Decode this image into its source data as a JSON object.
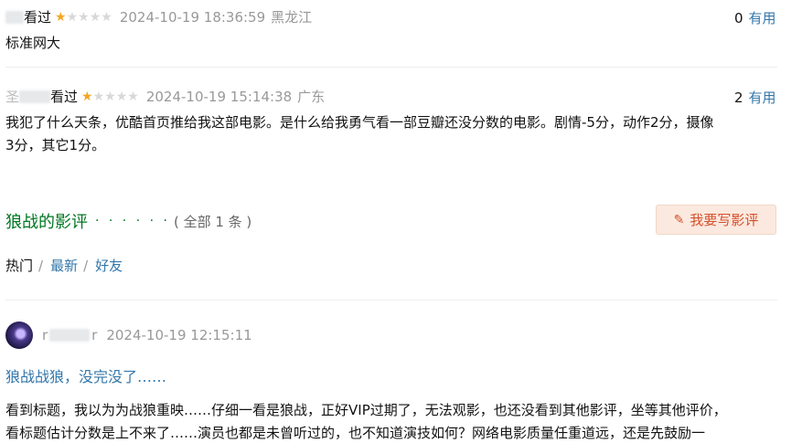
{
  "comments": [
    {
      "action": "看过",
      "stars": 1,
      "date": "2024-10-19 18:36:59",
      "location": "黑龙江",
      "useful_count": "0",
      "useful_label": "有用",
      "text": "标准网大",
      "author_prefix": "",
      "author_mid": ""
    },
    {
      "action": "看过",
      "stars": 1,
      "date": "2024-10-19 15:14:38",
      "location": "广东",
      "useful_count": "2",
      "useful_label": "有用",
      "text_line1": "我犯了什么天条，优酷首页推给我这部电影。是什么给我勇气看一部豆瓣还没分数的电影。剧情-5分，动作2分，摄像",
      "text_line2": "3分，其它1分。",
      "author_prefix": "圣",
      "author_mid": "看过"
    }
  ],
  "reviews_section": {
    "title": "狼战的影评",
    "dots": "· · · · · ·",
    "count": "( 全部 1 条 )",
    "write_button": "我要写影评",
    "tabs": {
      "hot": "热门",
      "latest": "最新",
      "friends": "好友",
      "sep": "/"
    }
  },
  "review": {
    "author_first": "r",
    "author_last": "r",
    "date": "2024-10-19 12:15:11",
    "title": "狼战战狼，没完没了……",
    "line1": "看到标题，我以为为战狼重映……仔细一看是狼战，正好VIP过期了，无法观影，也还没看到其他影评，坐等其他评价，",
    "line2": "看标题估计分数是上不来了……演员也都是未曾听过的，也不知道演技如何？网络电影质量任重道远，还是先鼓励一"
  }
}
